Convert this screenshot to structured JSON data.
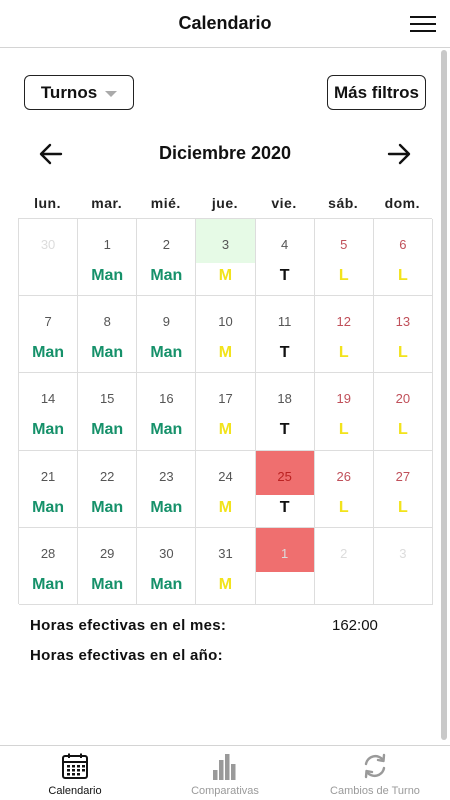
{
  "header": {
    "title": "Calendario"
  },
  "filters": {
    "turnos_label": "Turnos",
    "more_filters_label": "Más filtros"
  },
  "calendar": {
    "month_label": "Diciembre 2020",
    "weekdays": [
      "lun.",
      "mar.",
      "mié.",
      "jue.",
      "vie.",
      "sáb.",
      "dom."
    ],
    "weeks": [
      [
        {
          "day": "30",
          "shift": "",
          "kind": "other"
        },
        {
          "day": "1",
          "shift": "Man",
          "kind": "normal"
        },
        {
          "day": "2",
          "shift": "Man",
          "kind": "normal"
        },
        {
          "day": "3",
          "shift": "M",
          "kind": "today"
        },
        {
          "day": "4",
          "shift": "T",
          "kind": "normal"
        },
        {
          "day": "5",
          "shift": "L",
          "kind": "weekend"
        },
        {
          "day": "6",
          "shift": "L",
          "kind": "weekend"
        }
      ],
      [
        {
          "day": "7",
          "shift": "Man",
          "kind": "normal"
        },
        {
          "day": "8",
          "shift": "Man",
          "kind": "normal"
        },
        {
          "day": "9",
          "shift": "Man",
          "kind": "normal"
        },
        {
          "day": "10",
          "shift": "M",
          "kind": "normal"
        },
        {
          "day": "11",
          "shift": "T",
          "kind": "normal"
        },
        {
          "day": "12",
          "shift": "L",
          "kind": "weekend"
        },
        {
          "day": "13",
          "shift": "L",
          "kind": "weekend"
        }
      ],
      [
        {
          "day": "14",
          "shift": "Man",
          "kind": "normal"
        },
        {
          "day": "15",
          "shift": "Man",
          "kind": "normal"
        },
        {
          "day": "16",
          "shift": "Man",
          "kind": "normal"
        },
        {
          "day": "17",
          "shift": "M",
          "kind": "normal"
        },
        {
          "day": "18",
          "shift": "T",
          "kind": "normal"
        },
        {
          "day": "19",
          "shift": "L",
          "kind": "weekend"
        },
        {
          "day": "20",
          "shift": "L",
          "kind": "weekend"
        }
      ],
      [
        {
          "day": "21",
          "shift": "Man",
          "kind": "normal"
        },
        {
          "day": "22",
          "shift": "Man",
          "kind": "normal"
        },
        {
          "day": "23",
          "shift": "Man",
          "kind": "normal"
        },
        {
          "day": "24",
          "shift": "M",
          "kind": "normal"
        },
        {
          "day": "25",
          "shift": "T",
          "kind": "holiday"
        },
        {
          "day": "26",
          "shift": "L",
          "kind": "weekend"
        },
        {
          "day": "27",
          "shift": "L",
          "kind": "weekend"
        }
      ],
      [
        {
          "day": "28",
          "shift": "Man",
          "kind": "normal"
        },
        {
          "day": "29",
          "shift": "Man",
          "kind": "normal"
        },
        {
          "day": "30",
          "shift": "Man",
          "kind": "normal"
        },
        {
          "day": "31",
          "shift": "M",
          "kind": "normal"
        },
        {
          "day": "1",
          "shift": "",
          "kind": "holiday-other"
        },
        {
          "day": "2",
          "shift": "",
          "kind": "other"
        },
        {
          "day": "3",
          "shift": "",
          "kind": "other"
        }
      ]
    ]
  },
  "summary": {
    "month_label": "Horas efectivas en el mes:",
    "month_value": "162:00",
    "year_label": "Horas efectivas en el año:",
    "year_value": ""
  },
  "tabbar": {
    "tabs": [
      {
        "label": "Calendario",
        "icon": "calendar-icon",
        "active": true
      },
      {
        "label": "Comparativas",
        "icon": "bar-chart-icon",
        "active": false
      },
      {
        "label": "Cambios de Turno",
        "icon": "refresh-icon",
        "active": false
      }
    ]
  },
  "colors": {
    "shift_man": "#16916a",
    "shift_m_l": "#f2e31c",
    "today_bg": "#e6fae6",
    "holiday_bg": "#ef6f6f",
    "weekend_text": "#c0505a"
  }
}
